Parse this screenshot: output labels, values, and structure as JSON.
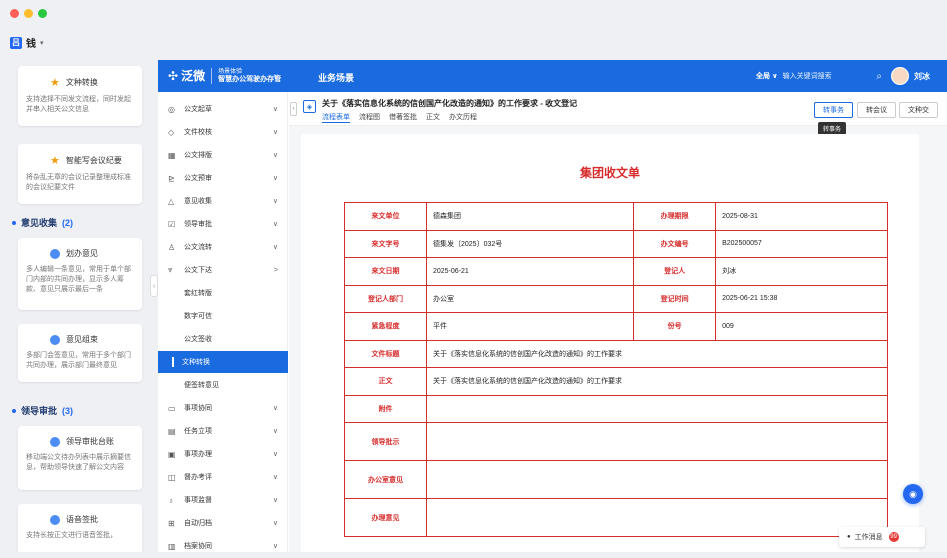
{
  "workspace": {
    "badge": "吕",
    "name": "钱",
    "caret": "▾"
  },
  "cards": {
    "c1": {
      "title": "文种转换",
      "desc": "支持选择不同发文流程，同时发起并串入相关公文信息"
    },
    "c2": {
      "title": "智能写会议纪要",
      "desc": "将杂乱无章的会议记录整理成标准的会议纪要文件"
    },
    "sec1": {
      "label": "意见收集",
      "count": "(2)"
    },
    "c3": {
      "title": "划办意见",
      "desc": "多人编辑一条意见，常用于单个部门内部的共同办理，显示多人筹款、意见只展示最后一条"
    },
    "c4": {
      "title": "意见组束",
      "desc": "多部门会签意见，常用于多个部门共同办理，展示部门最终意见"
    },
    "sec2": {
      "label": "领导审批",
      "count": "(3)"
    },
    "c5": {
      "title": "领导审批台账",
      "desc": "移动端公文待办列表中展示摘要信息，帮助领导快速了解公文内容"
    },
    "c6": {
      "title": "语音签批",
      "desc": "支持长按正文进行语音签批，"
    }
  },
  "topbar": {
    "logo": "泛微",
    "logo_sub1": "场景体验",
    "logo_sub2": "智慧办公驾驶办存管",
    "biz": "业务场景",
    "search_scope": "全局 ∨",
    "search_placeholder": "输入关键词搜索",
    "user": "刘冰"
  },
  "sidebar": {
    "items": [
      {
        "icon": "◎",
        "label": "公文起草",
        "arrow": "∨"
      },
      {
        "icon": "◇",
        "label": "文件校核",
        "arrow": "∨"
      },
      {
        "icon": "▦",
        "label": "公文排版",
        "arrow": "∨"
      },
      {
        "icon": "⊵",
        "label": "公文预审",
        "arrow": "∨"
      },
      {
        "icon": "△",
        "label": "意见收集",
        "arrow": "∨"
      },
      {
        "icon": "☑",
        "label": "领导审批",
        "arrow": "∨"
      },
      {
        "icon": "♙",
        "label": "公文流转",
        "arrow": "∨"
      },
      {
        "icon": "⩔",
        "label": "公文下达",
        "arrow": ">"
      }
    ],
    "subs": [
      "套红转版",
      "数字可信",
      "公文签收",
      "文种转换",
      "便签转意见"
    ],
    "items2": [
      {
        "icon": "▭",
        "label": "事项协同",
        "arrow": "∨"
      },
      {
        "icon": "▤",
        "label": "任务立项",
        "arrow": "∨"
      },
      {
        "icon": "▣",
        "label": "事项办理",
        "arrow": "∨"
      },
      {
        "icon": "◫",
        "label": "督办考评",
        "arrow": "∨"
      },
      {
        "icon": "♁",
        "label": "事项监督",
        "arrow": "∨"
      },
      {
        "icon": "⊞",
        "label": "自动归档",
        "arrow": "∨"
      },
      {
        "icon": "▥",
        "label": "档案协同",
        "arrow": "∨"
      }
    ]
  },
  "doc": {
    "title": "关于《落实信息化系统的信创国产化改造的通知》的工作要求 - 收文登记",
    "tabs": [
      "流程表单",
      "流程图",
      "借著签批",
      "正文",
      "办文历程"
    ],
    "btn_todo": "转事务",
    "btn_meeting": "转会议",
    "btn_transfer": "文种交",
    "tooltip": "转事务"
  },
  "form": {
    "title": "集团收文单",
    "rows": [
      {
        "l1": "来文单位",
        "v1": "德森集团",
        "l2": "办理期限",
        "v2": "2025-08-31"
      },
      {
        "l1": "来文字号",
        "v1": "德集发〔2025〕032号",
        "l2": "办文编号",
        "v2": "B202500057"
      },
      {
        "l1": "来文日期",
        "v1": "2025-06-21",
        "l2": "登记人",
        "v2": "刘冰"
      },
      {
        "l1": "登记人部门",
        "v1": "办公室",
        "l2": "登记时间",
        "v2": "2025-06-21 15:38"
      },
      {
        "l1": "紧急程度",
        "v1": "平件",
        "l2": "份号",
        "v2": "009"
      }
    ],
    "wide": [
      {
        "l": "文件标题",
        "v": "关于《落实信息化系统的信创国产化改造的通知》的工作要求"
      },
      {
        "l": "正文",
        "v": "关于《落实信息化系统的信创国产化改造的通知》的工作要求"
      },
      {
        "l": "附件",
        "v": ""
      },
      {
        "l": "领导批示",
        "v": ""
      },
      {
        "l": "办公室意见",
        "v": ""
      },
      {
        "l": "办理意见",
        "v": ""
      }
    ]
  },
  "footer": {
    "work_msg": "工作消息",
    "badge": "99"
  }
}
